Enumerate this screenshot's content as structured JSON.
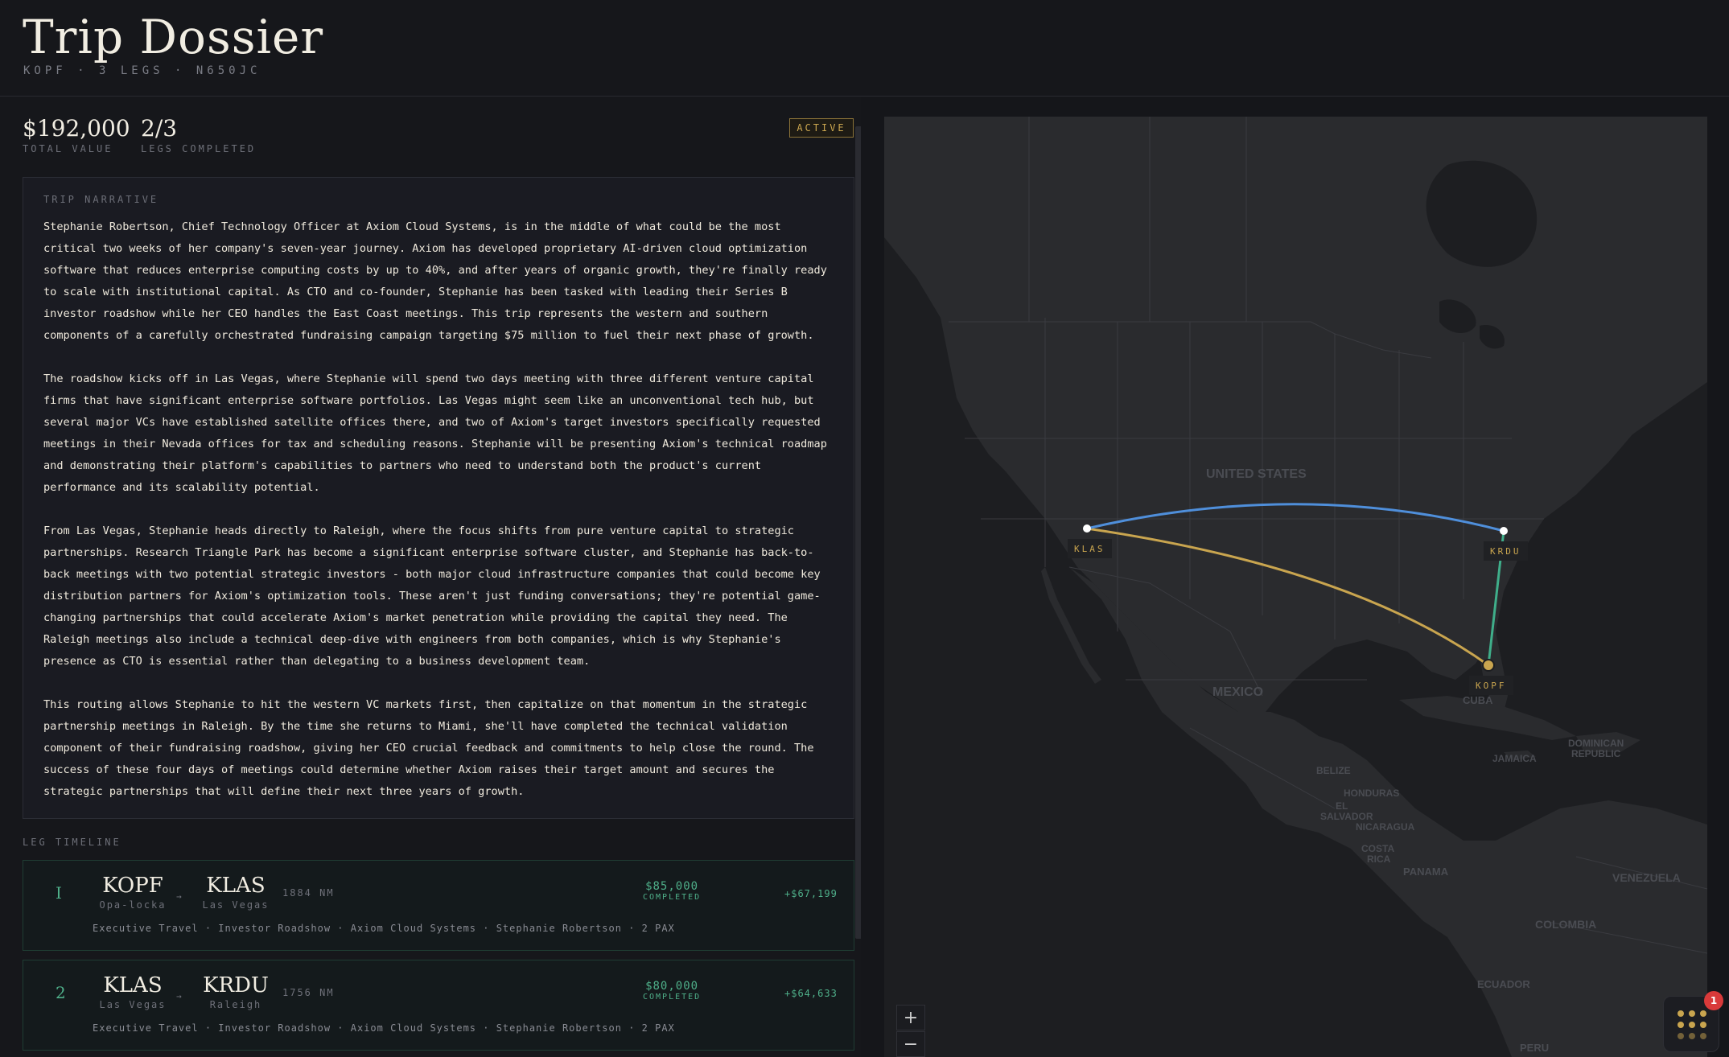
{
  "header": {
    "title": "Trip Dossier",
    "subtitle": "KOPF · 3 LEGS · N650JC"
  },
  "stats": {
    "total_value": "$192,000",
    "total_value_label": "TOTAL VALUE",
    "legs_completed": "2/3",
    "legs_completed_label": "LEGS COMPLETED",
    "status_badge": "ACTIVE"
  },
  "narrative": {
    "title": "TRIP NARRATIVE",
    "paragraphs": [
      "Stephanie Robertson, Chief Technology Officer at Axiom Cloud Systems, is in the middle of what could be the most critical two weeks of her company's seven-year journey. Axiom has developed proprietary AI-driven cloud optimization software that reduces enterprise computing costs by up to 40%, and after years of organic growth, they're finally ready to scale with institutional capital. As CTO and co-founder, Stephanie has been tasked with leading their Series B investor roadshow while her CEO handles the East Coast meetings. This trip represents the western and southern components of a carefully orchestrated fundraising campaign targeting $75 million to fuel their next phase of growth.",
      "The roadshow kicks off in Las Vegas, where Stephanie will spend two days meeting with three different venture capital firms that have significant enterprise software portfolios. Las Vegas might seem like an unconventional tech hub, but several major VCs have established satellite offices there, and two of Axiom's target investors specifically requested meetings in their Nevada offices for tax and scheduling reasons. Stephanie will be presenting Axiom's technical roadmap and demonstrating their platform's capabilities to partners who need to understand both the product's current performance and its scalability potential.",
      "From Las Vegas, Stephanie heads directly to Raleigh, where the focus shifts from pure venture capital to strategic partnerships. Research Triangle Park has become a significant enterprise software cluster, and Stephanie has back-to-back meetings with two potential strategic investors - both major cloud infrastructure companies that could become key distribution partners for Axiom's optimization tools. These aren't just funding conversations; they're potential game-changing partnerships that could accelerate Axiom's market penetration while providing the capital they need. The Raleigh meetings also include a technical deep-dive with engineers from both companies, which is why Stephanie's presence as CTO is essential rather than delegating to a business development team.",
      "This routing allows Stephanie to hit the western VC markets first, then capitalize on that momentum in the strategic partnership meetings in Raleigh. By the time she returns to Miami, she'll have completed the technical validation component of their fundraising roadshow, giving her CEO crucial feedback and commitments to help close the round. The success of these four days of meetings could determine whether Axiom raises their target amount and secures the strategic partnerships that will define their next three years of growth."
    ]
  },
  "timeline": {
    "label": "LEG TIMELINE",
    "legs": [
      {
        "number": "I",
        "from_code": "KOPF",
        "from_city": "Opa-locka",
        "arrow": "→",
        "to_code": "KLAS",
        "to_city": "Las Vegas",
        "distance": "1884 NM",
        "price": "$85,000",
        "status": "COMPLETED",
        "margin": "+$67,199",
        "description": "Executive Travel · Investor Roadshow · Axiom Cloud Systems · Stephanie Robertson · 2 PAX"
      },
      {
        "number": "2",
        "from_code": "KLAS",
        "from_city": "Las Vegas",
        "arrow": "→",
        "to_code": "KRDU",
        "to_city": "Raleigh",
        "distance": "1756 NM",
        "price": "$80,000",
        "status": "COMPLETED",
        "margin": "+$64,633",
        "description": "Executive Travel · Investor Roadshow · Axiom Cloud Systems · Stephanie Robertson · 2 PAX"
      }
    ]
  },
  "map": {
    "pins": {
      "klas": "KLAS",
      "krdu": "KRDU",
      "kopf": "KOPF"
    },
    "labels": {
      "united_states": "UNITED STATES",
      "mexico": "MEXICO",
      "cuba": "CUBA",
      "jamaica": "JAMAICA",
      "dominican_1": "DOMINICAN",
      "dominican_2": "REPUBLIC",
      "belize": "BELIZE",
      "honduras": "HONDURAS",
      "el_salvador_1": "EL",
      "el_salvador_2": "SALVADOR",
      "nicaragua": "NICARAGUA",
      "costa_rica_1": "COSTA",
      "costa_rica_2": "RICA",
      "panama": "PANAMA",
      "venezuela": "VENEZUELA",
      "colombia": "COLOMBIA",
      "ecuador": "ECUADOR",
      "peru": "PERU"
    },
    "route_colors": {
      "leg1": "#c9a54f",
      "leg2": "#4f8fdb",
      "leg3": "#3fae8a"
    },
    "zoom_in": "+",
    "zoom_out": "−",
    "notification_count": "1"
  }
}
